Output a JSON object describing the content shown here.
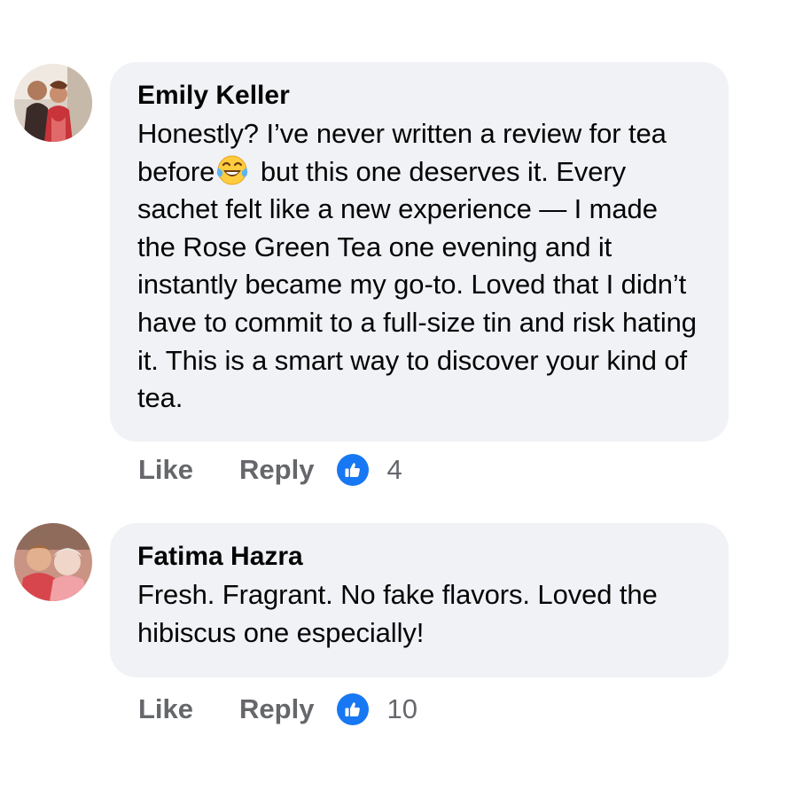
{
  "comments": [
    {
      "author": "Emily Keller",
      "text_before_emoji": "Honestly? I’ve never written a review for tea before",
      "emoji_icon": "face-with-tears-of-joy-emoji",
      "text_after_emoji": " but this one deserves it. Every sachet felt like a new experience — I made the Rose Green Tea one evening and it instantly became my go-to. Loved that I didn’t have to commit to a full-size tin and risk hating it. This is a smart way to discover your kind of tea.",
      "like_label": "Like",
      "reply_label": "Reply",
      "reaction_icon": "thumbs-up-icon",
      "reaction_count": "4"
    },
    {
      "author": "Fatima Hazra",
      "text": "Fresh. Fragrant. No fake flavors. Loved the hibiscus one especially!",
      "like_label": "Like",
      "reply_label": "Reply",
      "reaction_icon": "thumbs-up-icon",
      "reaction_count": "10"
    }
  ],
  "colors": {
    "bubble_background": "#f0f2f5",
    "secondary_text": "#65676b",
    "reaction_blue": "#1877f2"
  }
}
